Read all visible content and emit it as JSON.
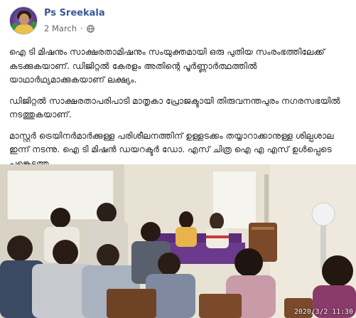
{
  "post": {
    "author": "Ps Sreekala",
    "date": "2 March",
    "separator": "·",
    "privacy_icon": "globe-icon",
    "paragraphs": [
      "ഐ ടി മിഷനും സാക്ഷരതാമിഷനും സംയുക്തമായി ഒരു പുതിയ സംരംഭത്തിലേക്ക് കടക്കുകയാണ്. ഡിജിറ്റൽ കേരളം അതിന്റെ പൂർണ്ണാർത്ഥത്തിൽ യാഥാർഥ്യമാക്കുകയാണ് ലക്ഷ്യം.",
      "ഡിജിറ്റൽ സാക്ഷരതാപരിപാടി മാതൃകാ പ്രോജക്ടായി തിരുവനന്തപുരം നഗരസഭയിൽ നടത്തുകയാണ്.",
      "മാസ്റ്റർ ട്രെയിനർമാർക്കുള്ള പരിശീലനത്തിന് ഉള്ളടക്കം തയ്യാറാക്കാനുള്ള ശില്പശാല ഇന്ന് നടന്നു. ഐ ടി മിഷൻ ഡയറക്ടർ ഡോ. എസ് ചിത്ര ഐ എ എസ് ഉൾപ്പെടെ പങ്കെടുത്തു."
    ],
    "photo_timestamp": "2020/3/2  11:30"
  },
  "colors": {
    "author_link": "#385898",
    "meta_text": "#616770",
    "body_text": "#1c1e21"
  }
}
